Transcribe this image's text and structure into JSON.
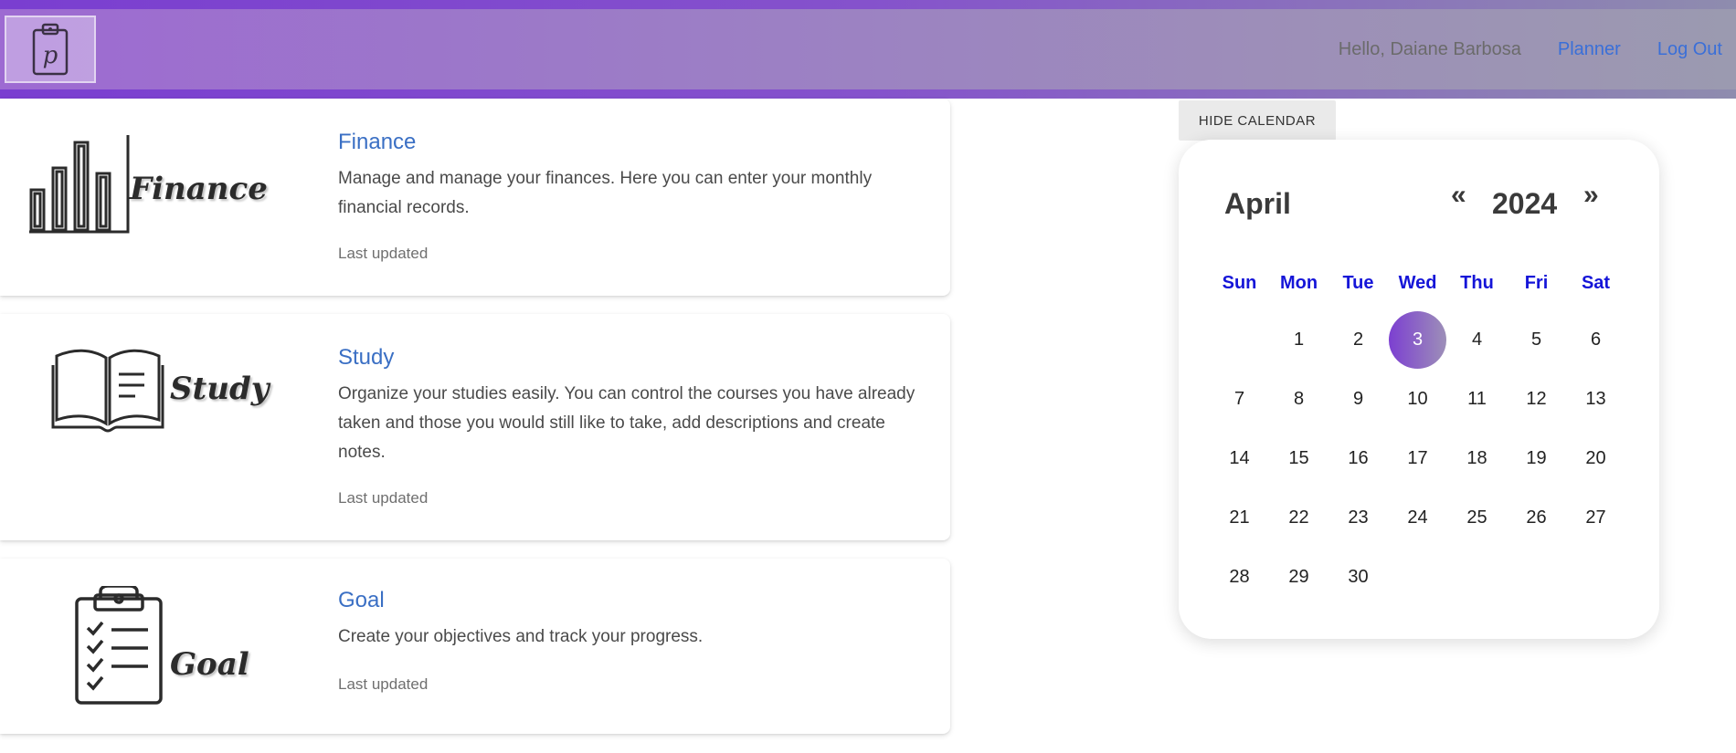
{
  "header": {
    "greeting": "Hello, Daiane Barbosa",
    "planner_label": "Planner",
    "logout_label": "Log Out",
    "logo_letter": "p"
  },
  "cards": [
    {
      "image_word": "Finance",
      "title": "Finance",
      "description": "Manage and manage your finances. Here you can enter your monthly financial records.",
      "updated": "Last updated"
    },
    {
      "image_word": "Study",
      "title": "Study",
      "description": "Organize your studies easily. You can control the courses you have already taken and those you would still like to take, add descriptions and create notes.",
      "updated": "Last updated"
    },
    {
      "image_word": "Goal",
      "title": "Goal",
      "description": "Create your objectives and track your progress.",
      "updated": "Last updated"
    }
  ],
  "calendar": {
    "hide_label": "HIDE CALENDAR",
    "month": "April",
    "year": "2024",
    "prev_label": "«",
    "next_label": "»",
    "weekdays": [
      "Sun",
      "Mon",
      "Tue",
      "Wed",
      "Thu",
      "Fri",
      "Sat"
    ],
    "selected_day": "3",
    "weeks": [
      [
        "",
        "1",
        "2",
        "3",
        "4",
        "5",
        "6"
      ],
      [
        "7",
        "8",
        "9",
        "10",
        "11",
        "12",
        "13"
      ],
      [
        "14",
        "15",
        "16",
        "17",
        "18",
        "19",
        "20"
      ],
      [
        "21",
        "22",
        "23",
        "24",
        "25",
        "26",
        "27"
      ],
      [
        "28",
        "29",
        "30",
        "",
        "",
        "",
        ""
      ]
    ]
  },
  "colors": {
    "accent": "#7c3fd1",
    "link": "#3a6fd8",
    "weekday": "#1515d8"
  }
}
